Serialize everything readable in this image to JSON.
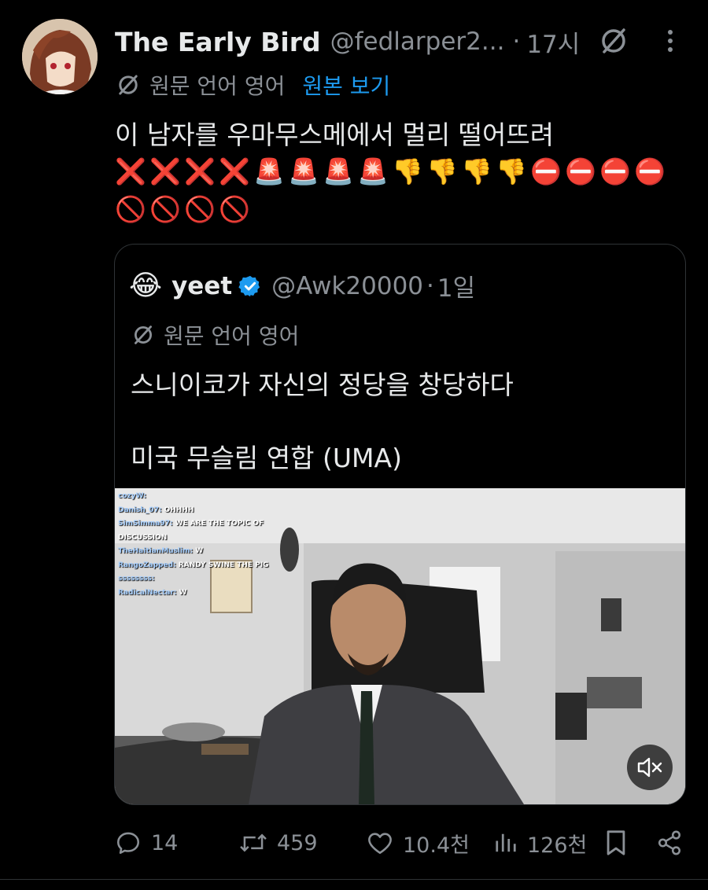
{
  "tweet": {
    "author_name": "The Early Bird",
    "handle": "@fedlarper2...",
    "separator": "·",
    "time": "17시",
    "translate_lang": "원문 언어 영어",
    "show_original": "원본 보기",
    "text": "이 남자를 우마무스메에서 멀리 떨어뜨려",
    "emojis_row1": [
      "❌",
      "❌",
      "❌",
      "❌",
      "🚨",
      "🚨",
      "🚨",
      "🚨",
      "👎",
      "👎",
      "👎",
      "👎",
      "⛔",
      "⛔",
      "⛔",
      "⛔"
    ],
    "emojis_row2": [
      "🚫",
      "🚫",
      "🚫",
      "🚫"
    ]
  },
  "quote": {
    "avatar_emoji": "😂",
    "author_name": "yeet",
    "verified": true,
    "handle": "@Awk20000",
    "separator": "·",
    "time": "1일",
    "translate_lang": "원문 언어 영어",
    "text_line1": "스니이코가 자신의 정당을 창당하다",
    "text_line2": "미국 무슬림 연합 (UMA)",
    "video": {
      "chat": [
        {
          "user": "cozyW:",
          "msg": ""
        },
        {
          "user": "Danish_07:",
          "msg": "OHHHH"
        },
        {
          "user": "SimSimma97:",
          "msg": "WE ARE THE TOPIC OF"
        },
        {
          "user": "",
          "msg": "DISCUSSION"
        },
        {
          "user": "TheHaitianMuslim:",
          "msg": "W"
        },
        {
          "user": "RangoZapped:",
          "msg": "RANDY SWINE THE PIG"
        },
        {
          "user": "ssssssss:",
          "msg": ""
        },
        {
          "user": "RadicalNectar:",
          "msg": "W"
        }
      ]
    }
  },
  "actions": {
    "replies": "14",
    "reposts": "459",
    "likes": "10.4천",
    "views": "126천"
  },
  "colors": {
    "background": "#000000",
    "text": "#e7e9ea",
    "muted": "#8b9096",
    "link": "#1d9bf0",
    "border": "#2f3336",
    "verified": "#1d9bf0"
  }
}
